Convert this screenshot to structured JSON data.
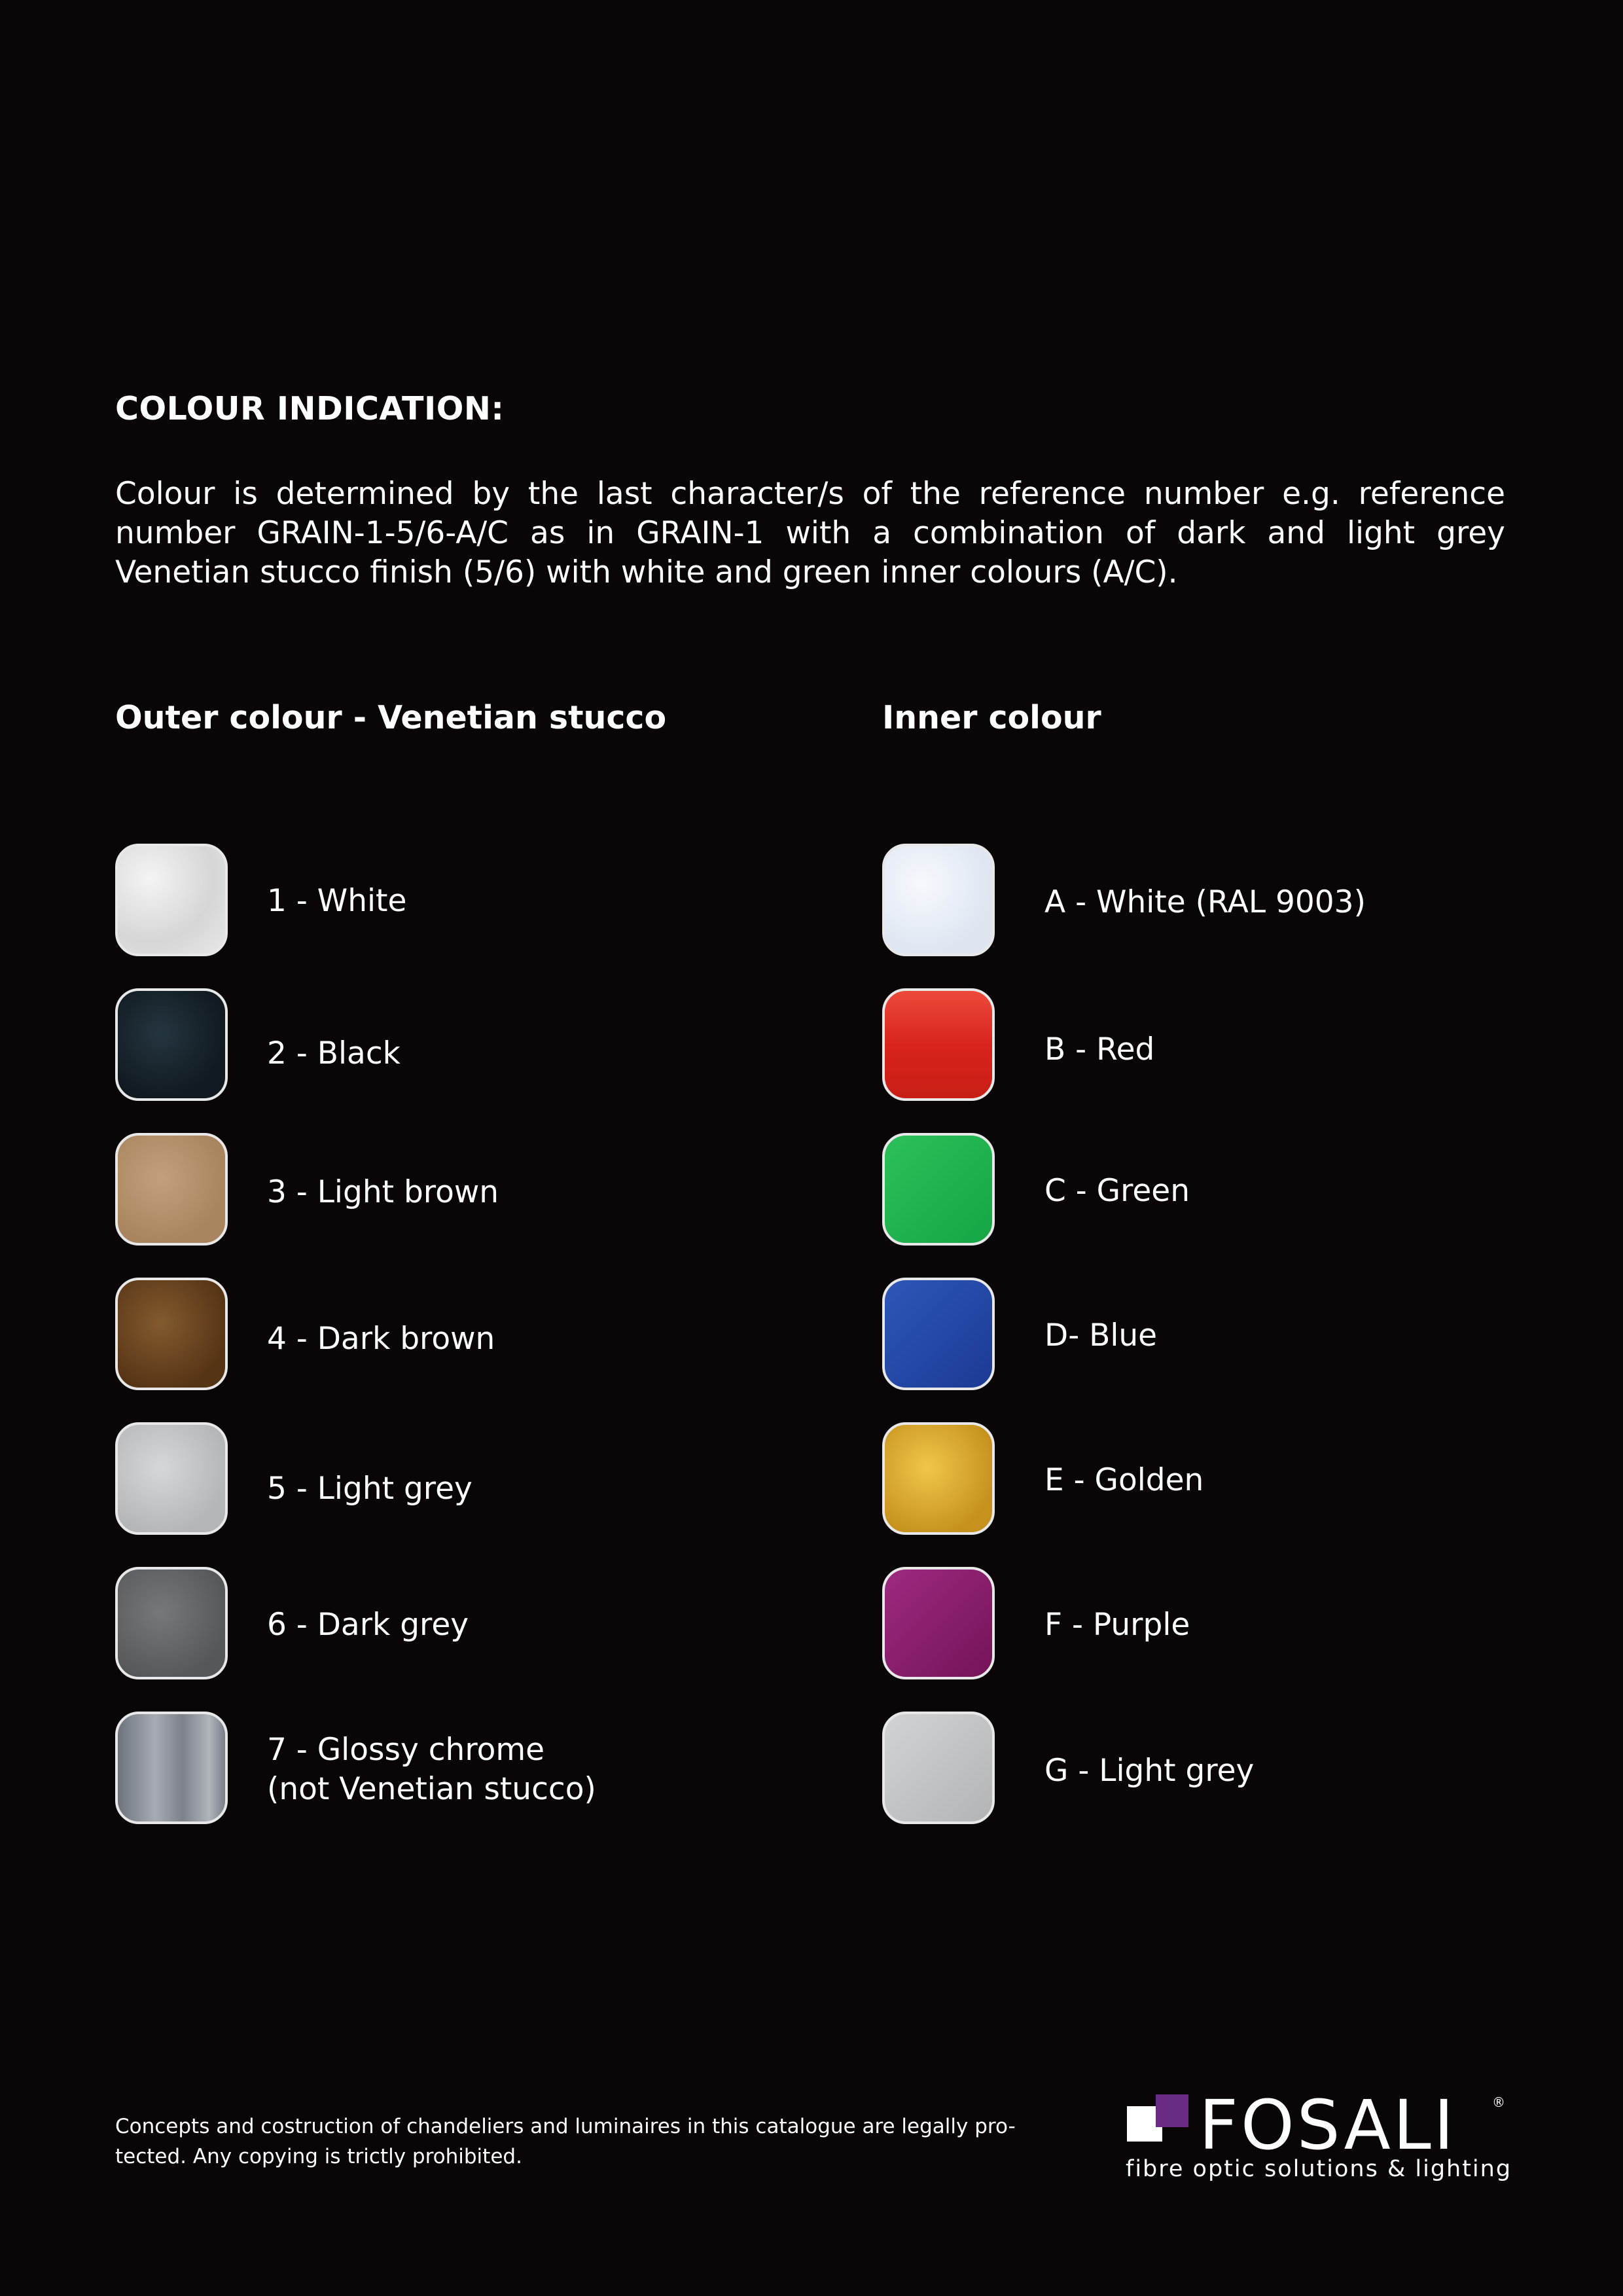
{
  "heading": "COLOUR INDICATION:",
  "intro": "Colour is determined by the last character/s of the reference number e.g. reference number GRAIN-1-5/6-A/C as in GRAIN-1 with a combination of dark and light grey Venetian stucco finish (5/6) with white and green inner colours (A/C).",
  "outer": {
    "title": "Outer colour - Venetian stucco",
    "items": [
      {
        "label": "1 - White",
        "color": "#e6e6e6"
      },
      {
        "label": "2 - Black",
        "color": "#18232a"
      },
      {
        "label": "3 - Light brown",
        "color": "#b4906c"
      },
      {
        "label": "4 - Dark brown",
        "color": "#6b4420"
      },
      {
        "label": "5 - Light grey",
        "color": "#c4c6ca"
      },
      {
        "label": "6 - Dark grey",
        "color": "#65676b"
      },
      {
        "label": "7 - Glossy chrome",
        "label2": "(not Venetian stucco)",
        "color": "#8e939c"
      }
    ]
  },
  "inner": {
    "title": "Inner colour",
    "items": [
      {
        "label": "A - White (RAL 9003)",
        "color": "#e8eef8"
      },
      {
        "label": "B - Red",
        "color": "#e12a20"
      },
      {
        "label": "C - Green",
        "color": "#1db24c"
      },
      {
        "label": "D- Blue",
        "color": "#2448a8"
      },
      {
        "label": "E - Golden",
        "color": "#d9a629"
      },
      {
        "label": "F - Purple",
        "color": "#8c1c6c"
      },
      {
        "label": "G - Light grey",
        "color": "#c2c3c5"
      }
    ]
  },
  "footer": {
    "line1": "Concepts and costruction of chandeliers and luminaires in this catalogue are legally pro-",
    "line2": "tected. Any copying is trictly prohibited."
  },
  "logo": {
    "wordmark": "FOSALI",
    "registered": "®",
    "tagline": "fibre optic solutions & lighting",
    "purple": "#6a2b86"
  }
}
